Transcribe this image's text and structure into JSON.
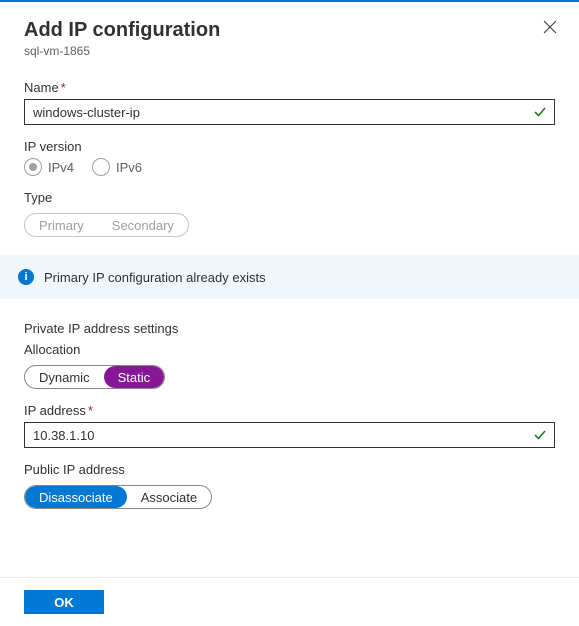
{
  "header": {
    "title": "Add IP configuration",
    "subtitle": "sql-vm-1865"
  },
  "fields": {
    "name": {
      "label": "Name",
      "value": "windows-cluster-ip"
    },
    "ipVersion": {
      "label": "IP version",
      "v4": "IPv4",
      "v6": "IPv6"
    },
    "type": {
      "label": "Type",
      "primary": "Primary",
      "secondary": "Secondary"
    },
    "info": "Primary IP configuration already exists",
    "privateSection": "Private IP address settings",
    "allocation": {
      "label": "Allocation",
      "dynamic": "Dynamic",
      "static": "Static"
    },
    "ipAddress": {
      "label": "IP address",
      "value": "10.38.1.10"
    },
    "publicIp": {
      "label": "Public IP address",
      "disassociate": "Disassociate",
      "associate": "Associate"
    }
  },
  "footer": {
    "ok": "OK"
  }
}
